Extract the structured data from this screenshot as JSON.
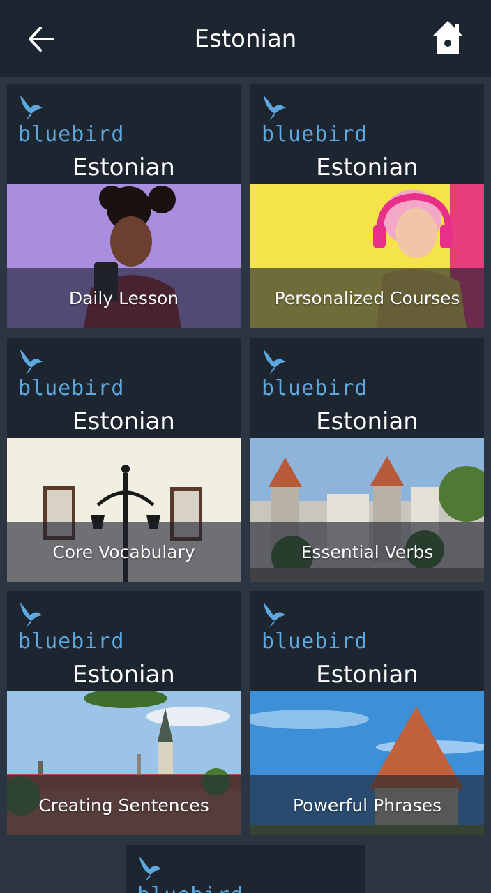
{
  "header": {
    "title": "Estonian",
    "back_icon": "arrow-left-icon",
    "home_icon": "home-icon"
  },
  "brand": {
    "name": "bluebird",
    "color": "#5da9df"
  },
  "cards": [
    {
      "language": "Estonian",
      "caption": "Daily Lesson"
    },
    {
      "language": "Estonian",
      "caption": "Personalized Courses"
    },
    {
      "language": "Estonian",
      "caption": "Core Vocabulary"
    },
    {
      "language": "Estonian",
      "caption": "Essential Verbs"
    },
    {
      "language": "Estonian",
      "caption": "Creating Sentences"
    },
    {
      "language": "Estonian",
      "caption": "Powerful Phrases"
    }
  ]
}
